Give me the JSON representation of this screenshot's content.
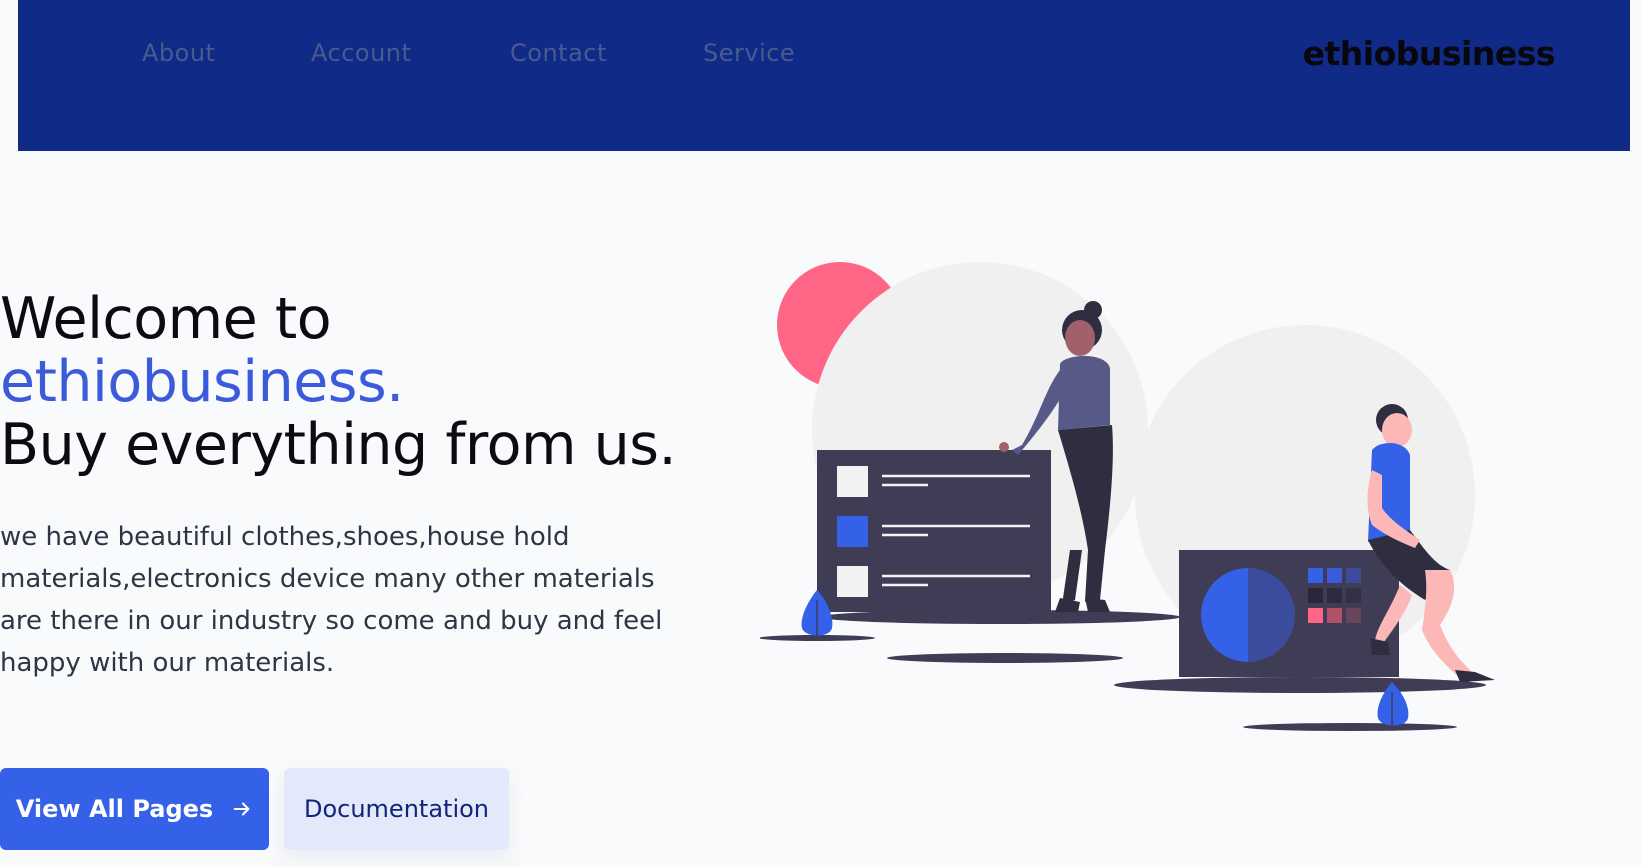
{
  "header": {
    "nav": [
      {
        "label": "About"
      },
      {
        "label": "Account"
      },
      {
        "label": "Contact"
      },
      {
        "label": "Service"
      }
    ],
    "brand": "ethiobusiness"
  },
  "hero": {
    "headline_line1": "Welcome to",
    "headline_accent": "ethiobusiness.",
    "headline_line3": "Buy everything from us.",
    "description": "we have beautiful clothes,shoes,house hold materials,electronics device many other materials are there in our industry so come and buy and feel happy with our materials.",
    "primary_button": "View All Pages",
    "secondary_button": "Documentation"
  },
  "colors": {
    "header_bg": "#102a87",
    "accent": "#3b5bdb",
    "primary_button": "#3560e8",
    "secondary_button": "#e3e8fb"
  },
  "icons": {
    "primary_button_icon": "arrow-right-icon"
  }
}
